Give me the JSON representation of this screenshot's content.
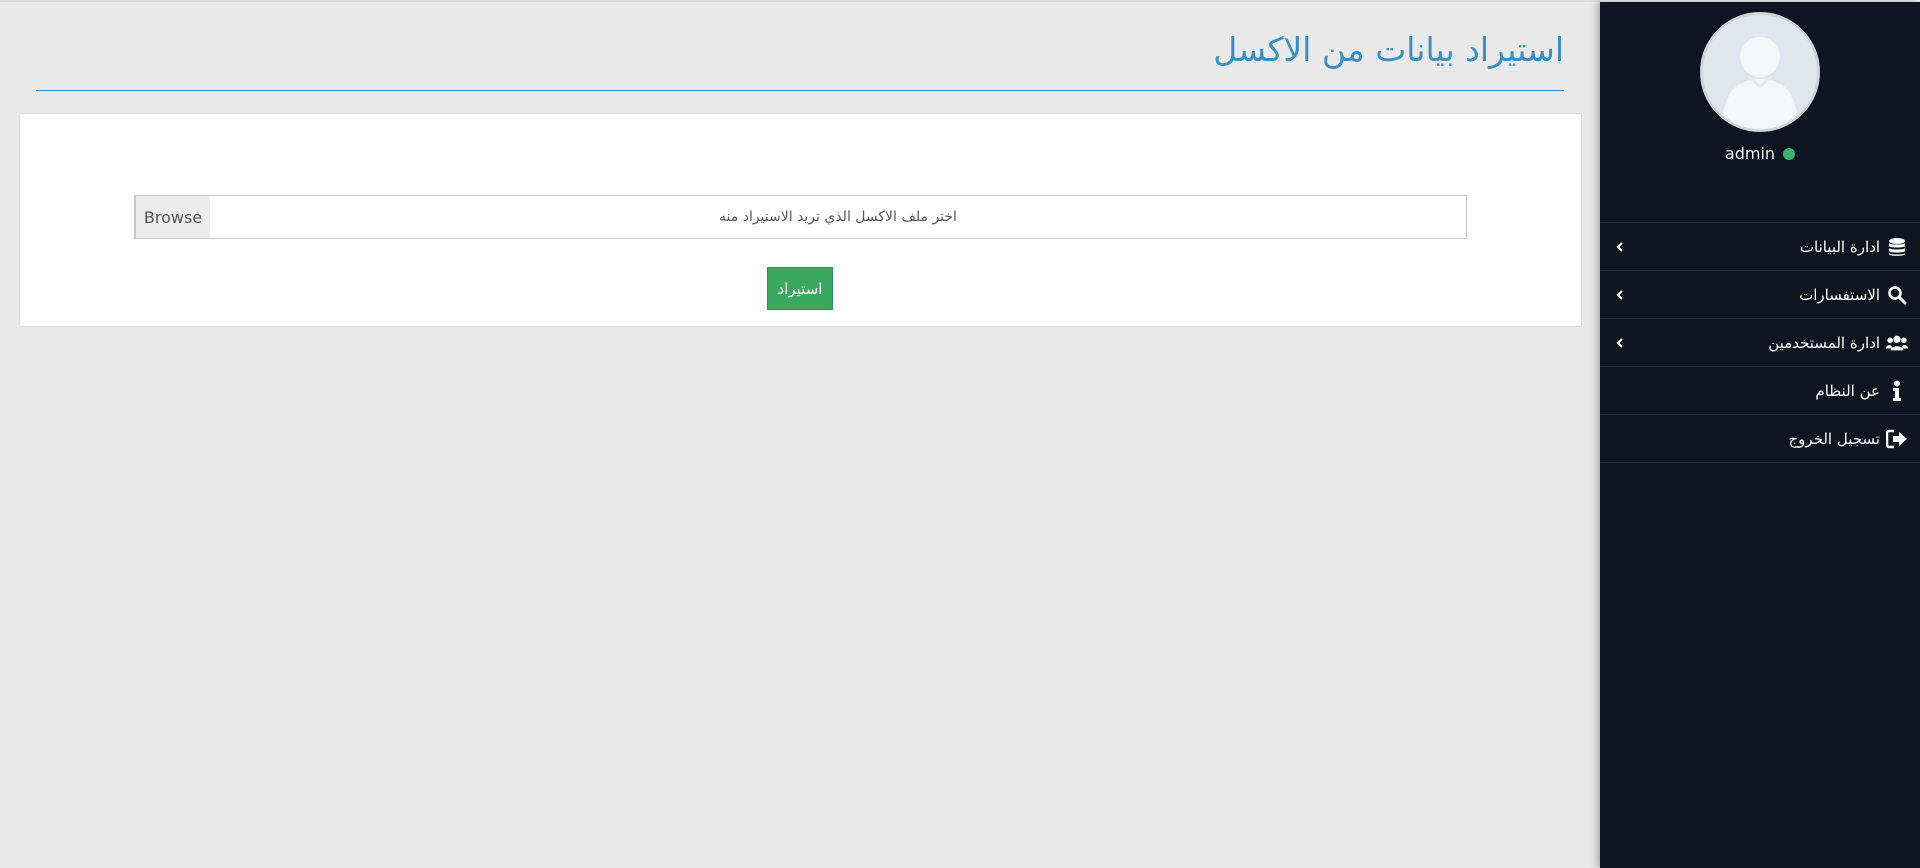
{
  "page": {
    "title": "استيراد بيانات من الاكسل"
  },
  "import_form": {
    "file_placeholder": "اختر ملف الاكسل الذي تريد الاستيراد منه",
    "browse_label": "Browse",
    "submit_label": "استيراد"
  },
  "sidebar": {
    "username": "admin",
    "status_color": "#3cb371",
    "items": [
      {
        "label": "ادارة البيانات",
        "icon": "database-icon",
        "has_submenu": true
      },
      {
        "label": "الاستفسارات",
        "icon": "search-icon",
        "has_submenu": true
      },
      {
        "label": "ادارة المستخدمين",
        "icon": "users-icon",
        "has_submenu": true
      },
      {
        "label": "عن النظام",
        "icon": "info-icon",
        "has_submenu": false
      },
      {
        "label": "تسجيل الخروج",
        "icon": "logout-icon",
        "has_submenu": false
      }
    ]
  },
  "colors": {
    "accent": "#3b8fc0",
    "sidebar_bg": "#0f1520",
    "import_button": "#3aa85e",
    "content_bg": "#e9e9e9"
  }
}
